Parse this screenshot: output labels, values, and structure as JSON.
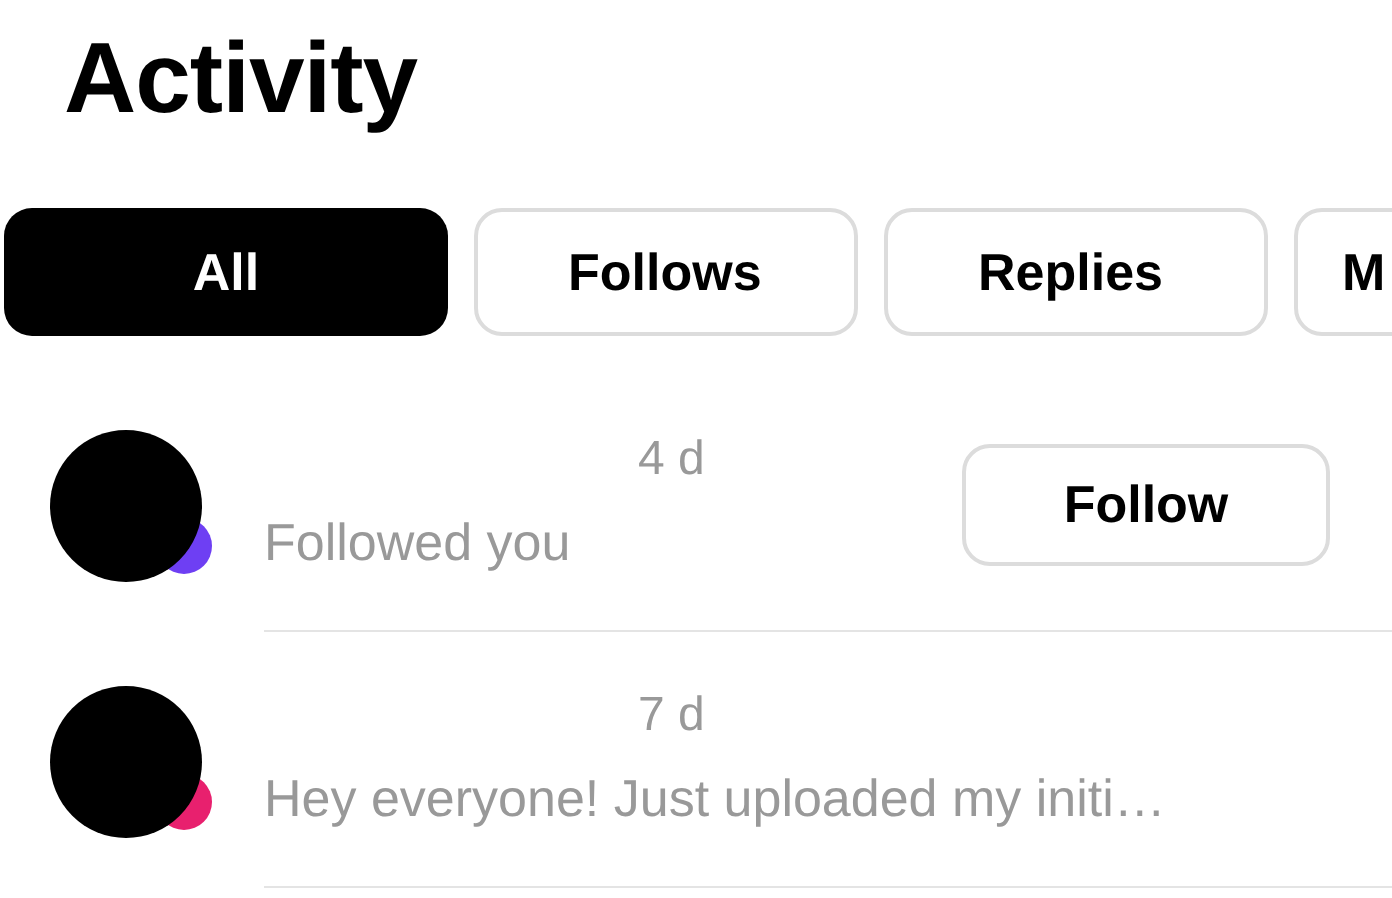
{
  "title": "Activity",
  "tabs": [
    {
      "label": "All",
      "selected": true
    },
    {
      "label": "Follows",
      "selected": false
    },
    {
      "label": "Replies",
      "selected": false
    },
    {
      "label": "M",
      "selected": false
    }
  ],
  "items": [
    {
      "time": "4 d",
      "text": "Followed you",
      "color": "#6e3ff3",
      "action": "Follow"
    },
    {
      "time": "7 d",
      "text": "Hey everyone! Just uploaded my initi…",
      "color": "#e8206e"
    }
  ]
}
